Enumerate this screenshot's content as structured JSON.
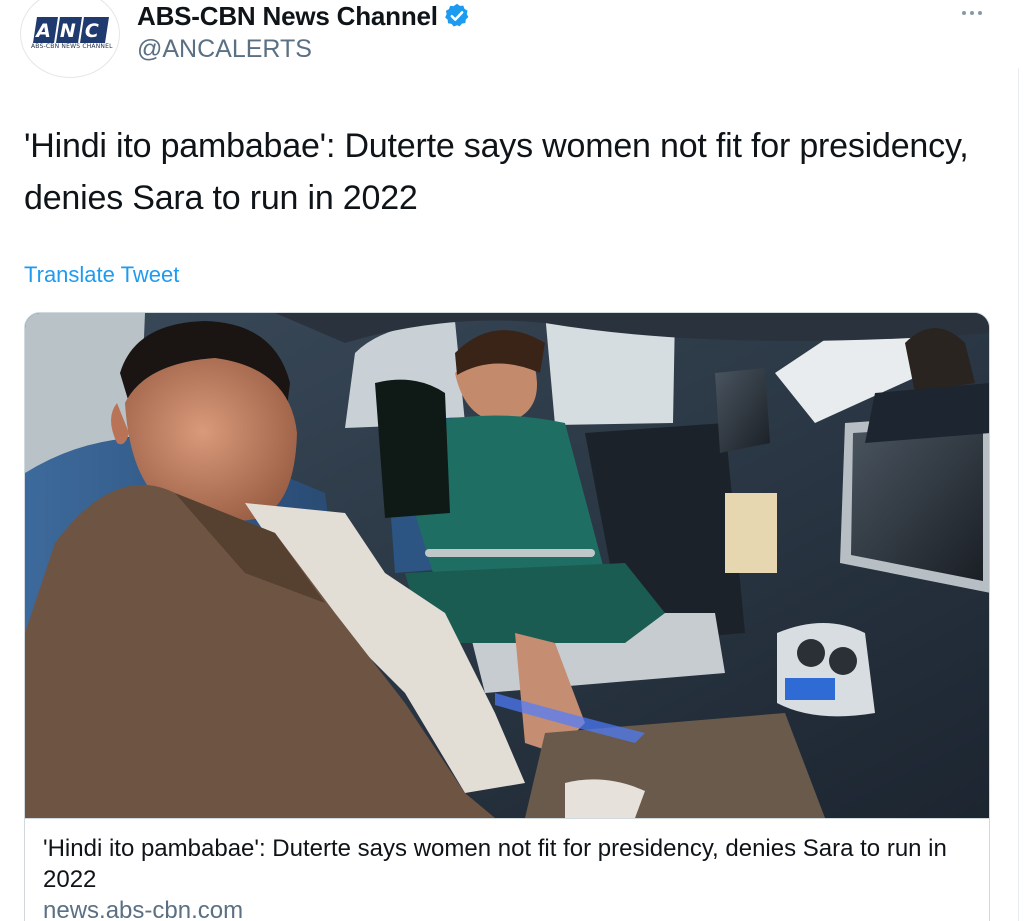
{
  "account": {
    "display_name": "ABS-CBN News Channel",
    "handle": "@ANCALERTS",
    "verified": true,
    "avatar_logo_text": "ANC",
    "avatar_sub_text": "ABS-CBN NEWS CHANNEL"
  },
  "tweet": {
    "text": "'Hindi ito pambabae': Duterte says women not fit for presidency, denies Sara to run in 2022",
    "translate_label": "Translate Tweet"
  },
  "card": {
    "title": "'Hindi ito pambabae': Duterte says women not fit for presidency, denies Sara to run in 2022",
    "domain": "news.abs-cbn.com"
  },
  "icons": {
    "verified": "verified-badge-icon",
    "more": "more-horizontal-icon"
  },
  "colors": {
    "accent": "#1d9bf0",
    "secondary_text": "#5b7083",
    "verified": "#1d9bf0",
    "brand_navy": "#1f3a6e"
  }
}
